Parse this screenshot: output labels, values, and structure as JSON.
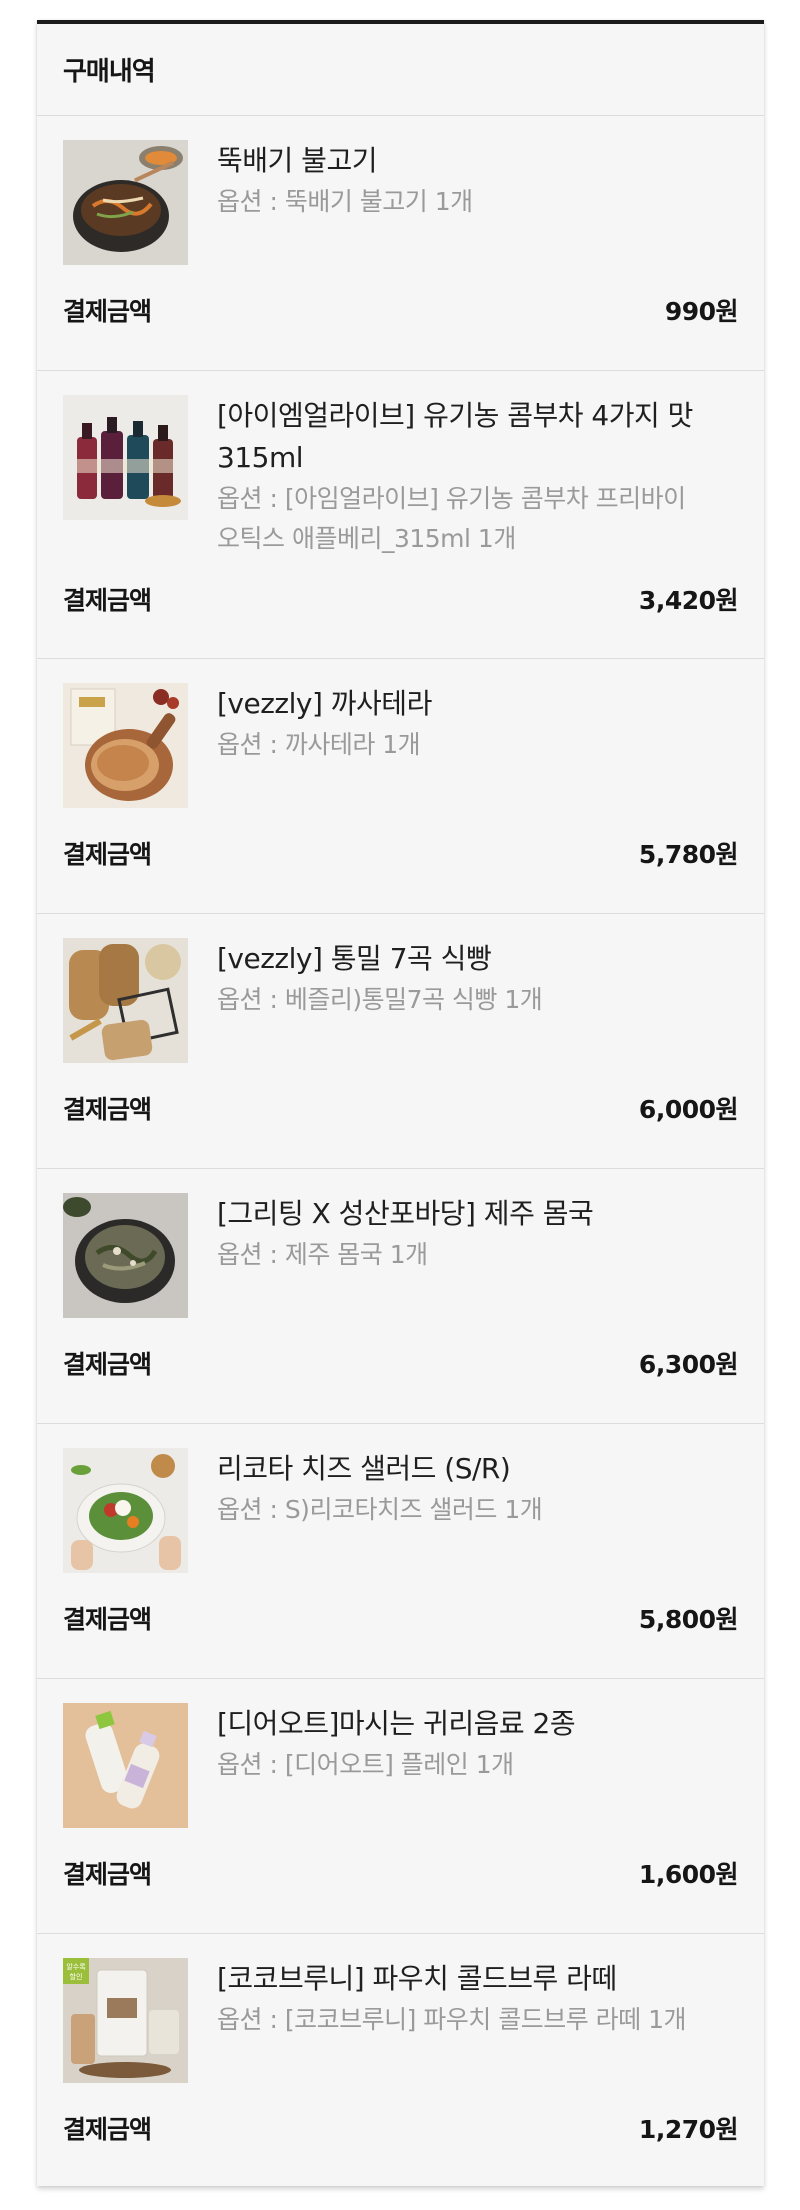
{
  "header": {
    "title": "구매내역"
  },
  "items": [
    {
      "title": "뚝배기 불고기",
      "option": "옵션 : 뚝배기 불고기 1개",
      "pay_label": "결제금액",
      "pay_amount": "990원",
      "image": "bulgogi-pot-image"
    },
    {
      "title": "[아이엠얼라이브] 유기농 콤부차 4가지 맛 315ml",
      "option": "옵션 : [아임얼라이브] 유기농 콤부차 프리바이오틱스 애플베리_315ml 1개",
      "pay_label": "결제금액",
      "pay_amount": "3,420원",
      "image": "kombucha-bottles-image"
    },
    {
      "title": "[vezzly] 까사테라",
      "option": "옵션 : 까사테라 1개",
      "pay_label": "결제금액",
      "pay_amount": "5,780원",
      "image": "bread-board-image"
    },
    {
      "title": "[vezzly] 통밀 7곡 식빵",
      "option": "옵션 : 베즐리)통밀7곡 식빵 1개",
      "pay_label": "결제금액",
      "pay_amount": "6,000원",
      "image": "wholewheat-bread-image"
    },
    {
      "title": "[그리팅 X 성산포바당] 제주 몸국",
      "option": "옵션 : 제주 몸국 1개",
      "pay_label": "결제금액",
      "pay_amount": "6,300원",
      "image": "momguk-soup-image"
    },
    {
      "title": "리코타 치즈 샐러드 (S/R)",
      "option": "옵션 : S)리코타치즈 샐러드 1개",
      "pay_label": "결제금액",
      "pay_amount": "5,800원",
      "image": "ricotta-salad-image"
    },
    {
      "title": "[디어오트]마시는 귀리음료 2종",
      "option": "옵션 : [디어오트] 플레인 1개",
      "pay_label": "결제금액",
      "pay_amount": "1,600원",
      "image": "oat-drink-bottles-image"
    },
    {
      "title": "[코코브루니] 파우치 콜드브루 라떼",
      "option": "옵션 : [코코브루니] 파우치 콜드브루 라떼 1개",
      "pay_label": "결제금액",
      "pay_amount": "1,270원",
      "image": "coldbrew-pouch-image",
      "badge_text": "알수록 할인"
    }
  ]
}
